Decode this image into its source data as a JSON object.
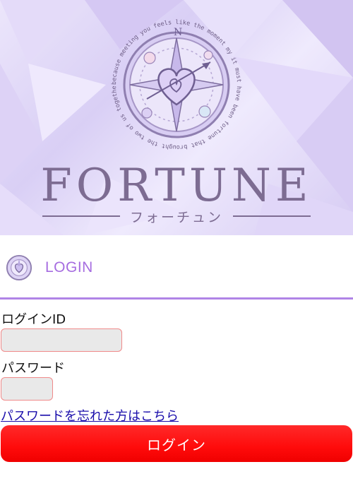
{
  "hero": {
    "emblem_text": "because meeting you feels like the moment my it must have been fortune that brought the two of us together,",
    "brand_name": "FORTUNE",
    "brand_subtitle": "フォーチュン"
  },
  "login": {
    "section_title": "LOGIN",
    "id_label": "ログインID",
    "id_value": "",
    "password_label": "パスワード",
    "password_value": "",
    "forgot_link": "パスワードを忘れた方はこちら",
    "submit_label": "ログイン"
  },
  "colors": {
    "brand": "#7d6c92",
    "accent": "#a66de0",
    "divider": "#b084e6",
    "button": "#ff0b0b",
    "field_border": "#f08a8a",
    "link": "#1a0dab"
  }
}
